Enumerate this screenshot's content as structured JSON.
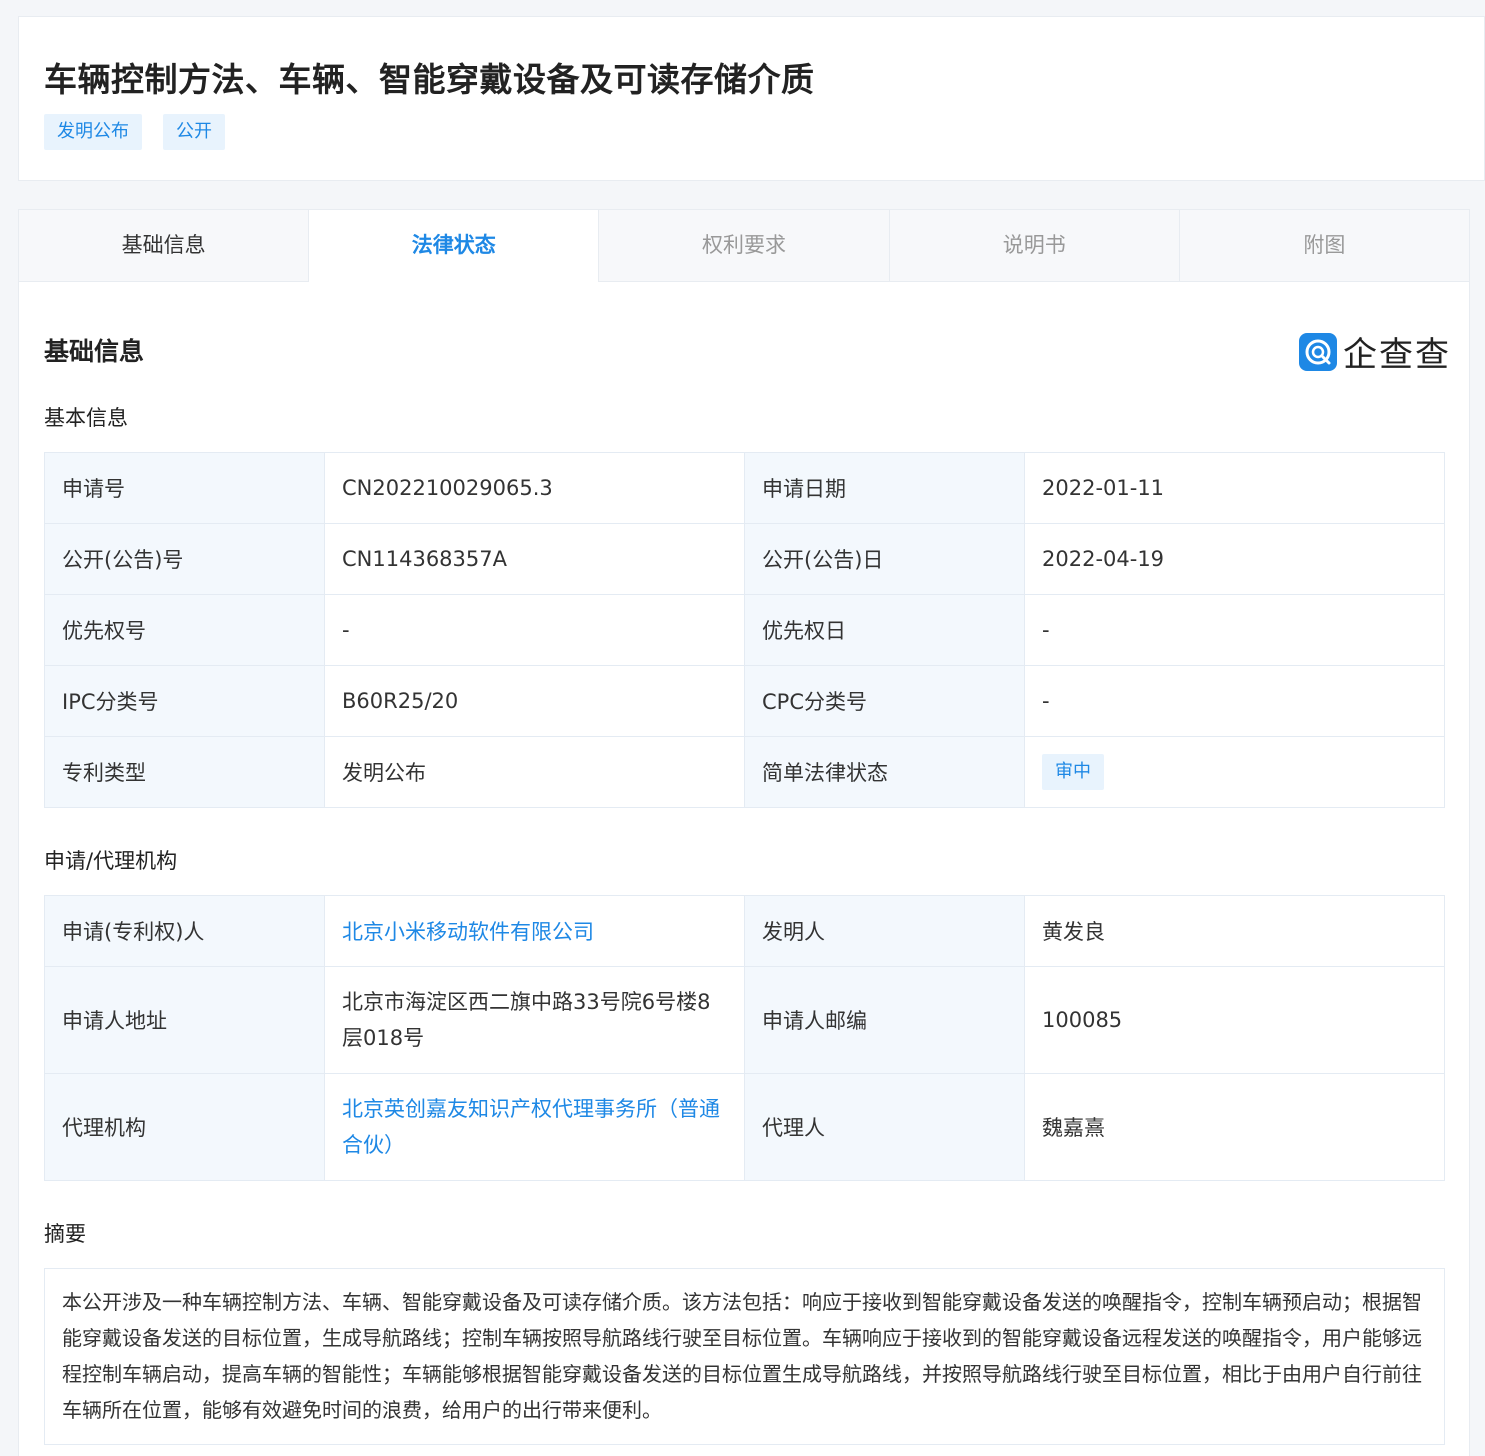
{
  "header": {
    "title": "车辆控制方法、车辆、智能穿戴设备及可读存储介质",
    "tags": [
      "发明公布",
      "公开"
    ]
  },
  "tabs": [
    "基础信息",
    "法律状态",
    "权利要求",
    "说明书",
    "附图"
  ],
  "section": {
    "title": "基础信息",
    "logo_text": "企查查"
  },
  "basic": {
    "title": "基本信息",
    "rows": [
      {
        "k1": "申请号",
        "v1": "CN202210029065.3",
        "k2": "申请日期",
        "v2": "2022-01-11"
      },
      {
        "k1": "公开(公告)号",
        "v1": "CN114368357A",
        "k2": "公开(公告)日",
        "v2": "2022-04-19"
      },
      {
        "k1": "优先权号",
        "v1": "-",
        "k2": "优先权日",
        "v2": "-"
      },
      {
        "k1": "IPC分类号",
        "v1": "B60R25/20",
        "k2": "CPC分类号",
        "v2": "-"
      },
      {
        "k1": "专利类型",
        "v1": "发明公布",
        "k2": "简单法律状态",
        "v2": "审中"
      }
    ]
  },
  "agency": {
    "title": "申请/代理机构",
    "rows": [
      {
        "k1": "申请(专利权)人",
        "v1": "北京小米移动软件有限公司",
        "k2": "发明人",
        "v2": "黄发良"
      },
      {
        "k1": "申请人地址",
        "v1": "北京市海淀区西二旗中路33号院6号楼8层018号",
        "k2": "申请人邮编",
        "v2": "100085"
      },
      {
        "k1": "代理机构",
        "v1": "北京英创嘉友知识产权代理事务所（普通合伙）",
        "k2": "代理人",
        "v2": "魏嘉熹"
      }
    ]
  },
  "abstract": {
    "title": "摘要",
    "text": "本公开涉及一种车辆控制方法、车辆、智能穿戴设备及可读存储介质。该方法包括：响应于接收到智能穿戴设备发送的唤醒指令，控制车辆预启动；根据智能穿戴设备发送的目标位置，生成导航路线；控制车辆按照导航路线行驶至目标位置。车辆响应于接收到的智能穿戴设备远程发送的唤醒指令，用户能够远程控制车辆启动，提高车辆的智能性；车辆能够根据智能穿戴设备发送的目标位置生成导航路线，并按照导航路线行驶至目标位置，相比于由用户自行前往车辆所在位置，能够有效避免时间的浪费，给用户的出行带来便利。"
  },
  "colors": {
    "accent": "#1e88e5",
    "key_bg": "#f3f8fd"
  }
}
